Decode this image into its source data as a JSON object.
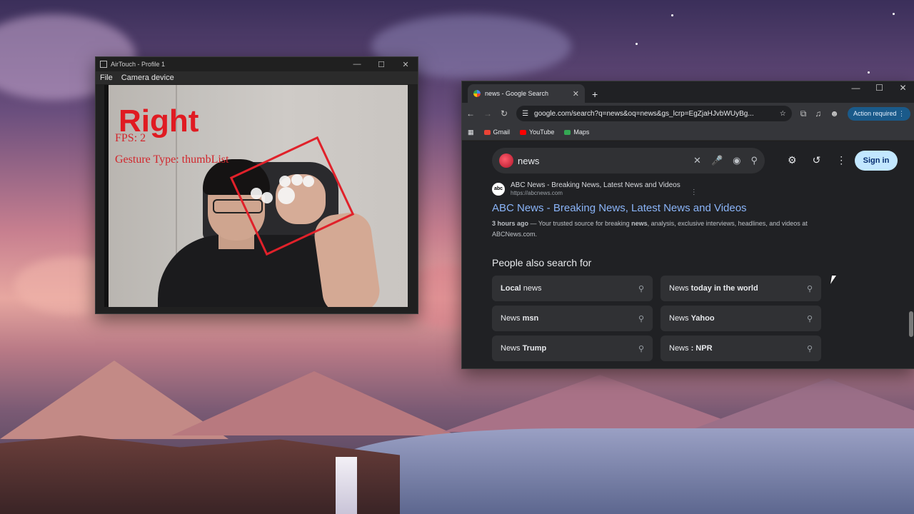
{
  "airtouch": {
    "title": "AirTouch - Profile 1",
    "menu": [
      "File",
      "Camera device"
    ],
    "overlay": {
      "hand_label": "Right",
      "fps": "FPS: 2",
      "gesture": "Gesture Type: thumbList"
    }
  },
  "chrome": {
    "tab_title": "news - Google Search",
    "new_tab": "+",
    "url": "google.com/search?q=news&oq=news&gs_lcrp=EgZjaHJvbWUyBg...",
    "action_required": "Action required",
    "bookmarks": [
      "Gmail",
      "YouTube",
      "Maps"
    ],
    "search": {
      "query": "news"
    },
    "signin": "Sign in",
    "result": {
      "site_name": "ABC News - Breaking News, Latest News and Videos",
      "url": "https://abcnews.com",
      "logo": "abc",
      "title": "ABC News - Breaking News, Latest News and Videos",
      "time": "3 hours ago",
      "snippet_1": " — Your trusted source for breaking ",
      "snippet_bold": "news",
      "snippet_2": ", analysis, exclusive interviews, headlines, and videos at ABCNews.com."
    },
    "people_also_search": {
      "title": "People also search for",
      "items": [
        {
          "pre": "",
          "bold": "Local",
          "post": " news"
        },
        {
          "pre": "News ",
          "bold": "today in the world",
          "post": ""
        },
        {
          "pre": "News ",
          "bold": "msn",
          "post": ""
        },
        {
          "pre": "News ",
          "bold": "Yahoo",
          "post": ""
        },
        {
          "pre": "News ",
          "bold": "Trump",
          "post": ""
        },
        {
          "pre": "News ",
          "bold": ": NPR",
          "post": ""
        }
      ]
    }
  }
}
